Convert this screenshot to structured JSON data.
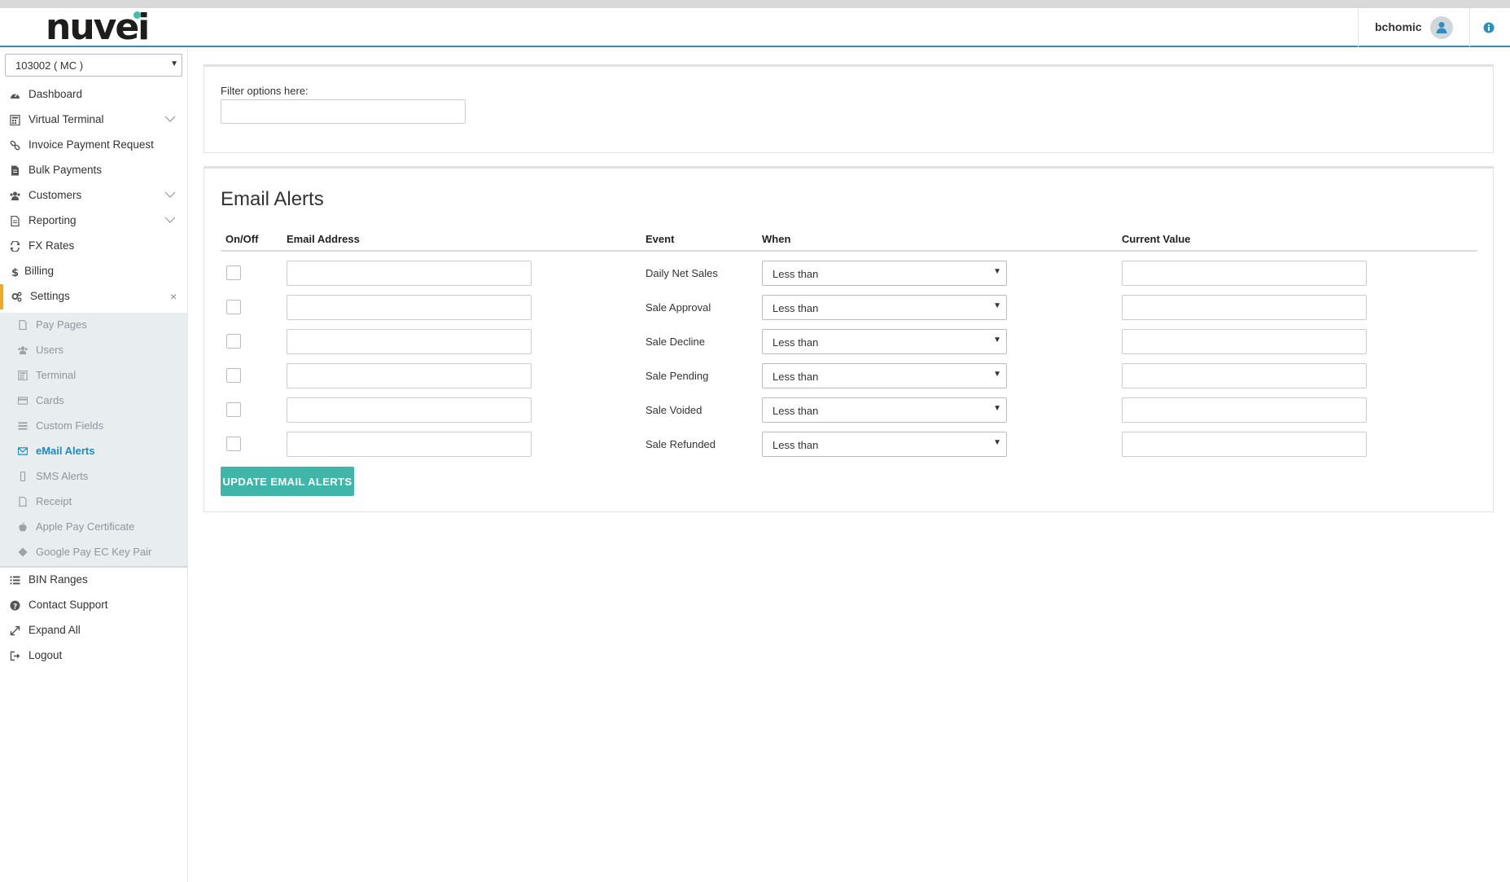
{
  "header": {
    "logo_text": "nuvei",
    "username": "bchomic",
    "icons": {
      "user": "user-icon",
      "info": "info-icon"
    }
  },
  "sidebar": {
    "merchant_select": "103002 ( MC )",
    "items": [
      {
        "label": "Dashboard",
        "icon": "dashboard-icon"
      },
      {
        "label": "Virtual Terminal",
        "icon": "calculator-icon",
        "expandable": true
      },
      {
        "label": "Invoice Payment Request",
        "icon": "link-icon"
      },
      {
        "label": "Bulk Payments",
        "icon": "file-icon"
      },
      {
        "label": "Customers",
        "icon": "users-icon",
        "expandable": true
      },
      {
        "label": "Reporting",
        "icon": "report-icon",
        "expandable": true
      },
      {
        "label": "FX Rates",
        "icon": "exchange-icon"
      },
      {
        "label": "Billing",
        "icon": "dollar-icon"
      },
      {
        "label": "Settings",
        "icon": "cogs-icon",
        "expanded": true
      }
    ],
    "settings_submenu": [
      {
        "label": "Pay Pages",
        "icon": "file-icon"
      },
      {
        "label": "Users",
        "icon": "users-icon"
      },
      {
        "label": "Terminal",
        "icon": "calculator-icon"
      },
      {
        "label": "Cards",
        "icon": "card-icon"
      },
      {
        "label": "Custom Fields",
        "icon": "list-icon"
      },
      {
        "label": "eMail Alerts",
        "icon": "envelope-icon",
        "selected": true
      },
      {
        "label": "SMS Alerts",
        "icon": "mobile-icon"
      },
      {
        "label": "Receipt",
        "icon": "file-icon"
      },
      {
        "label": "Apple Pay Certificate",
        "icon": "apple-icon"
      },
      {
        "label": "Google Pay EC Key Pair",
        "icon": "android-icon"
      }
    ],
    "bottom_items": [
      {
        "label": "BIN Ranges",
        "icon": "list-icon"
      },
      {
        "label": "Contact Support",
        "icon": "question-icon"
      },
      {
        "label": "Expand All",
        "icon": "expand-icon"
      },
      {
        "label": "Logout",
        "icon": "logout-icon"
      }
    ],
    "colors": {
      "active_accent": "#f2a823",
      "selected_sub": "#1b8bc0"
    }
  },
  "filter": {
    "label": "Filter options here:",
    "value": "",
    "placeholder": ""
  },
  "alerts": {
    "title": "Email Alerts",
    "columns": [
      "On/Off",
      "Email Address",
      "Event",
      "When",
      "Current Value"
    ],
    "rows": [
      {
        "enabled": false,
        "email": "",
        "event": "Daily Net Sales",
        "when": "Less than",
        "current_value": ""
      },
      {
        "enabled": false,
        "email": "",
        "event": "Sale Approval",
        "when": "Less than",
        "current_value": ""
      },
      {
        "enabled": false,
        "email": "",
        "event": "Sale Decline",
        "when": "Less than",
        "current_value": ""
      },
      {
        "enabled": false,
        "email": "",
        "event": "Sale Pending",
        "when": "Less than",
        "current_value": ""
      },
      {
        "enabled": false,
        "email": "",
        "event": "Sale Voided",
        "when": "Less than",
        "current_value": ""
      },
      {
        "enabled": false,
        "email": "",
        "event": "Sale Refunded",
        "when": "Less than",
        "current_value": ""
      }
    ],
    "update_button": "UPDATE EMAIL ALERTS",
    "button_color": "#3fb6a8"
  }
}
